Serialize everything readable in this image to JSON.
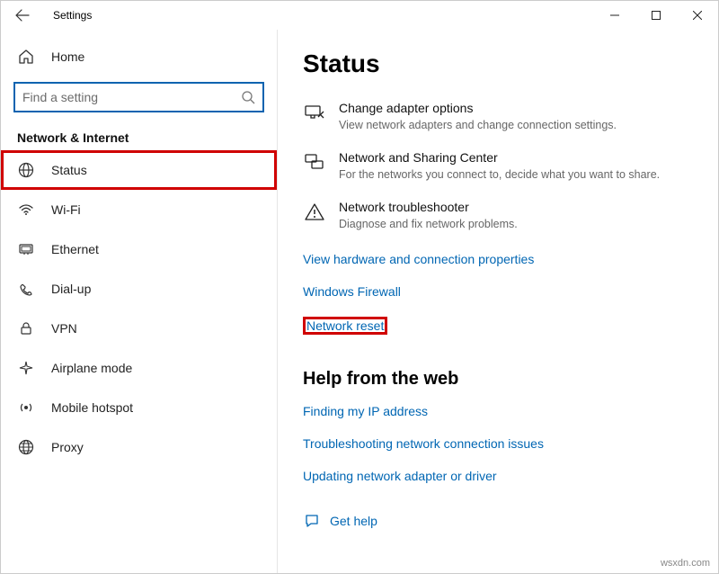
{
  "window": {
    "title": "Settings"
  },
  "sidebar": {
    "home_label": "Home",
    "search_placeholder": "Find a setting",
    "section_title": "Network & Internet",
    "items": [
      {
        "label": "Status"
      },
      {
        "label": "Wi-Fi"
      },
      {
        "label": "Ethernet"
      },
      {
        "label": "Dial-up"
      },
      {
        "label": "VPN"
      },
      {
        "label": "Airplane mode"
      },
      {
        "label": "Mobile hotspot"
      },
      {
        "label": "Proxy"
      }
    ]
  },
  "content": {
    "heading": "Status",
    "settings": [
      {
        "title": "Change adapter options",
        "desc": "View network adapters and change connection settings."
      },
      {
        "title": "Network and Sharing Center",
        "desc": "For the networks you connect to, decide what you want to share."
      },
      {
        "title": "Network troubleshooter",
        "desc": "Diagnose and fix network problems."
      }
    ],
    "links": [
      "View hardware and connection properties",
      "Windows Firewall",
      "Network reset"
    ],
    "help_heading": "Help from the web",
    "help_links": [
      "Finding my IP address",
      "Troubleshooting network connection issues",
      "Updating network adapter or driver"
    ],
    "get_help": "Get help"
  },
  "watermark": "wsxdn.com"
}
